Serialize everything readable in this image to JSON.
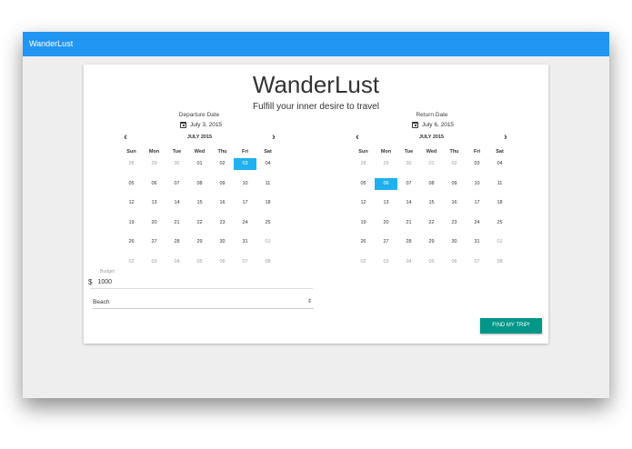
{
  "app": {
    "title": "WanderLust"
  },
  "card": {
    "title": "WanderLust",
    "subtitle": "Fulfill your inner desire to travel"
  },
  "departure": {
    "label": "Departure Date",
    "value": "July 3, 2015",
    "calendar": {
      "month": "JULY 2015",
      "prev_icon": "chevron-left",
      "next_icon": "chevron-right",
      "weekdays": [
        "Sun",
        "Mon",
        "Tue",
        "Wed",
        "Thu",
        "Fri",
        "Sat"
      ],
      "weeks": [
        [
          "28",
          "29",
          "30",
          "01",
          "02",
          "03",
          "04"
        ],
        [
          "05",
          "06",
          "07",
          "08",
          "09",
          "10",
          "11"
        ],
        [
          "12",
          "13",
          "14",
          "15",
          "16",
          "17",
          "18"
        ],
        [
          "19",
          "20",
          "21",
          "22",
          "23",
          "24",
          "25"
        ],
        [
          "26",
          "27",
          "28",
          "29",
          "30",
          "31",
          "01"
        ],
        [
          "02",
          "03",
          "04",
          "05",
          "06",
          "07",
          "08"
        ]
      ],
      "muted": [
        [
          0,
          0
        ],
        [
          0,
          1
        ],
        [
          0,
          2
        ],
        [
          4,
          6
        ],
        [
          5,
          0
        ],
        [
          5,
          1
        ],
        [
          5,
          2
        ],
        [
          5,
          3
        ],
        [
          5,
          4
        ],
        [
          5,
          5
        ],
        [
          5,
          6
        ]
      ],
      "selected": [
        0,
        5
      ]
    }
  },
  "return": {
    "label": "Return Date",
    "value": "July 6, 2015",
    "calendar": {
      "month": "JULY 2015",
      "prev_icon": "chevron-left",
      "next_icon": "chevron-right",
      "weekdays": [
        "Sun",
        "Mon",
        "Tue",
        "Wed",
        "Thu",
        "Fri",
        "Sat"
      ],
      "weeks": [
        [
          "28",
          "29",
          "30",
          "01",
          "02",
          "03",
          "04"
        ],
        [
          "05",
          "06",
          "07",
          "08",
          "09",
          "10",
          "11"
        ],
        [
          "12",
          "13",
          "14",
          "15",
          "16",
          "17",
          "18"
        ],
        [
          "19",
          "20",
          "21",
          "22",
          "23",
          "24",
          "25"
        ],
        [
          "26",
          "27",
          "28",
          "29",
          "30",
          "31",
          "01"
        ],
        [
          "02",
          "03",
          "04",
          "05",
          "06",
          "07",
          "08"
        ]
      ],
      "muted": [
        [
          0,
          0
        ],
        [
          0,
          1
        ],
        [
          0,
          2
        ],
        [
          0,
          3
        ],
        [
          0,
          4
        ],
        [
          4,
          6
        ],
        [
          5,
          0
        ],
        [
          5,
          1
        ],
        [
          5,
          2
        ],
        [
          5,
          3
        ],
        [
          5,
          4
        ],
        [
          5,
          5
        ],
        [
          5,
          6
        ]
      ],
      "selected": [
        1,
        1
      ]
    }
  },
  "budget": {
    "label": "Budget",
    "currency": "$",
    "value": "1000"
  },
  "destination": {
    "value": "Beach",
    "caret": "⇕"
  },
  "actions": {
    "find_label": "FIND MY TRIP!"
  },
  "colors": {
    "appbar": "#2196f3",
    "selected_day": "#1fb0f0",
    "button": "#009688",
    "background": "#eeeeee"
  }
}
